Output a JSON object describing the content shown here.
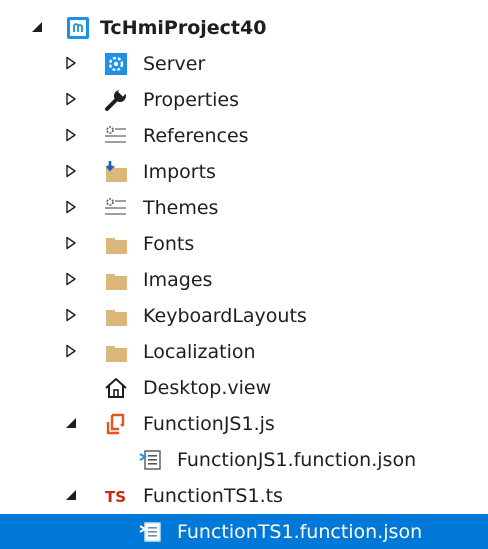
{
  "tree": {
    "project": {
      "label": "TcHmiProject40",
      "expanded": true,
      "icon": "hmi-project-icon"
    },
    "server": {
      "label": "Server",
      "expanded": false,
      "icon": "server-gear-icon"
    },
    "properties": {
      "label": "Properties",
      "expanded": false,
      "icon": "wrench-icon"
    },
    "references": {
      "label": "References",
      "expanded": false,
      "icon": "references-icon"
    },
    "imports": {
      "label": "Imports",
      "expanded": false,
      "icon": "imports-folder-icon"
    },
    "themes": {
      "label": "Themes",
      "expanded": false,
      "icon": "themes-icon"
    },
    "fonts": {
      "label": "Fonts",
      "expanded": false,
      "icon": "folder-icon"
    },
    "images": {
      "label": "Images",
      "expanded": false,
      "icon": "folder-icon"
    },
    "keyboard_layouts": {
      "label": "KeyboardLayouts",
      "expanded": false,
      "icon": "folder-icon"
    },
    "localization": {
      "label": "Localization",
      "expanded": false,
      "icon": "folder-icon"
    },
    "desktop_view": {
      "label": "Desktop.view",
      "icon": "home-icon"
    },
    "function_js": {
      "label": "FunctionJS1.js",
      "expanded": true,
      "icon": "js-function-icon"
    },
    "function_js_json": {
      "label": "FunctionJS1.function.json",
      "icon": "json-file-icon"
    },
    "function_ts": {
      "label": "FunctionTS1.ts",
      "expanded": true,
      "icon": "ts-icon",
      "icon_text": "TS"
    },
    "function_ts_json": {
      "label": "FunctionTS1.function.json",
      "icon": "json-file-icon",
      "selected": true
    }
  },
  "colors": {
    "selection": "#0078d7",
    "folder": "#dcb67a",
    "server_blue": "#1e90e6",
    "ts_red": "#c7290e",
    "js_orange": "#e8531e",
    "text": "#1e1e1e"
  }
}
